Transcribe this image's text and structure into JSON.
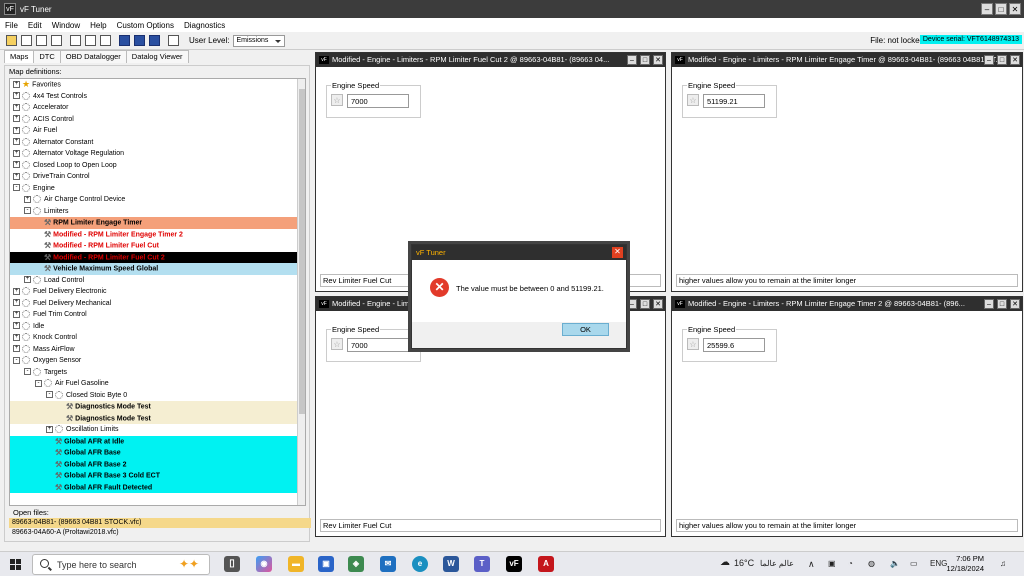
{
  "app": {
    "title": "vF Tuner"
  },
  "menu": [
    "File",
    "Edit",
    "Window",
    "Help",
    "Custom Options",
    "Diagnostics"
  ],
  "toolbar": {
    "user_level_label": "User Level:",
    "user_level_value": "Emissions",
    "file_status": "File: not locked",
    "device_serial": "Device serial: VFT6148974313"
  },
  "left": {
    "tabs": [
      "Maps",
      "DTC",
      "OBD Datalogger",
      "Datalog Viewer"
    ],
    "map_definitions_label": "Map definitions:",
    "tree": [
      {
        "label": "Favorites",
        "indent": 0,
        "exp": "+",
        "icon": "star",
        "style": ""
      },
      {
        "label": "4x4 Test Controls",
        "indent": 0,
        "exp": "+",
        "icon": "gear",
        "style": ""
      },
      {
        "label": "Accelerator",
        "indent": 0,
        "exp": "+",
        "icon": "gear",
        "style": ""
      },
      {
        "label": "ACIS Control",
        "indent": 0,
        "exp": "+",
        "icon": "gear",
        "style": ""
      },
      {
        "label": "Air Fuel",
        "indent": 0,
        "exp": "+",
        "icon": "gear",
        "style": ""
      },
      {
        "label": "Alternator Constant",
        "indent": 0,
        "exp": "+",
        "icon": "gear",
        "style": ""
      },
      {
        "label": "Alternator Voltage Regulation",
        "indent": 0,
        "exp": "+",
        "icon": "gear",
        "style": ""
      },
      {
        "label": "Closed Loop to Open Loop",
        "indent": 0,
        "exp": "+",
        "icon": "gear",
        "style": ""
      },
      {
        "label": "DriveTrain Control",
        "indent": 0,
        "exp": "+",
        "icon": "gear",
        "style": ""
      },
      {
        "label": "Engine",
        "indent": 0,
        "exp": "-",
        "icon": "gear",
        "style": ""
      },
      {
        "label": "Air Charge Control Device",
        "indent": 1,
        "exp": "+",
        "icon": "gear",
        "style": ""
      },
      {
        "label": "Limiters",
        "indent": 1,
        "exp": "-",
        "icon": "gear",
        "style": ""
      },
      {
        "label": "RPM Limiter Engage Timer",
        "indent": 2,
        "exp": "",
        "icon": "wrench",
        "style": "orange"
      },
      {
        "label": "Modified - RPM Limiter Engage Timer 2",
        "indent": 2,
        "exp": "",
        "icon": "wrench",
        "style": "redtxt"
      },
      {
        "label": "Modified - RPM Limiter Fuel Cut",
        "indent": 2,
        "exp": "",
        "icon": "wrench",
        "style": "redtxt"
      },
      {
        "label": "Modified - RPM Limiter Fuel Cut 2",
        "indent": 2,
        "exp": "",
        "icon": "wrench",
        "style": "black"
      },
      {
        "label": "Vehicle Maximum Speed Global",
        "indent": 2,
        "exp": "",
        "icon": "wrench",
        "style": "lblue"
      },
      {
        "label": "Load Control",
        "indent": 1,
        "exp": "+",
        "icon": "gear",
        "style": ""
      },
      {
        "label": "Fuel Delivery Electronic",
        "indent": 0,
        "exp": "+",
        "icon": "gear",
        "style": ""
      },
      {
        "label": "Fuel Delivery Mechanical",
        "indent": 0,
        "exp": "+",
        "icon": "gear",
        "style": ""
      },
      {
        "label": "Fuel Trim Control",
        "indent": 0,
        "exp": "+",
        "icon": "gear",
        "style": ""
      },
      {
        "label": "Idle",
        "indent": 0,
        "exp": "+",
        "icon": "gear",
        "style": ""
      },
      {
        "label": "Knock Control",
        "indent": 0,
        "exp": "+",
        "icon": "gear",
        "style": ""
      },
      {
        "label": "Mass AirFlow",
        "indent": 0,
        "exp": "+",
        "icon": "gear",
        "style": ""
      },
      {
        "label": "Oxygen Sensor",
        "indent": 0,
        "exp": "-",
        "icon": "gear",
        "style": ""
      },
      {
        "label": "Targets",
        "indent": 1,
        "exp": "-",
        "icon": "gear",
        "style": ""
      },
      {
        "label": "Air Fuel Gasoline",
        "indent": 2,
        "exp": "-",
        "icon": "gear",
        "style": ""
      },
      {
        "label": "Closed Stoic Byte 0",
        "indent": 3,
        "exp": "-",
        "icon": "gear",
        "style": ""
      },
      {
        "label": "Diagnostics Mode Test",
        "indent": 4,
        "exp": "",
        "icon": "wrench",
        "style": "beige"
      },
      {
        "label": "Diagnostics Mode Test",
        "indent": 4,
        "exp": "",
        "icon": "wrench",
        "style": "beige"
      },
      {
        "label": "Oscillation Limits",
        "indent": 3,
        "exp": "+",
        "icon": "gear",
        "style": ""
      },
      {
        "label": "Global AFR at Idle",
        "indent": 3,
        "exp": "",
        "icon": "wrench",
        "style": "cyan"
      },
      {
        "label": "Global AFR Base",
        "indent": 3,
        "exp": "",
        "icon": "wrench",
        "style": "cyan"
      },
      {
        "label": "Global AFR Base 2",
        "indent": 3,
        "exp": "",
        "icon": "wrench",
        "style": "cyan"
      },
      {
        "label": "Global AFR Base 3 Cold ECT",
        "indent": 3,
        "exp": "",
        "icon": "wrench",
        "style": "cyan"
      },
      {
        "label": "Global AFR Fault Detected",
        "indent": 3,
        "exp": "",
        "icon": "wrench",
        "style": "cyan"
      }
    ],
    "open_files_label": "Open files:",
    "open_files": [
      "89663-04B81- (89663 04B81 STOCK.vfc)",
      "89663-04A60-A (Proltawi2018.vfc)"
    ]
  },
  "windows": [
    {
      "title": "Modified - Engine - Limiters - RPM Limiter Fuel Cut 2 @ 89663-04B81- (89663 04...",
      "group_label": "Engine Speed",
      "value": "7000",
      "desc": "Rev Limiter Fuel Cut"
    },
    {
      "title": "Modified - Engine - Limiters - RPM Limiter Engage Timer @ 89663-04B81- (89663 04B81 ST...",
      "group_label": "Engine Speed",
      "value": "51199.21",
      "desc": "higher values allow you to remain at the limiter longer"
    },
    {
      "title": "Modified - Engine - Limiters",
      "group_label": "Engine Speed",
      "value": "7000",
      "desc": "Rev Limiter Fuel Cut"
    },
    {
      "title": "Modified - Engine - Limiters - RPM Limiter Engage Timer 2 @ 89663-04B81- (896...",
      "group_label": "Engine Speed",
      "value": "25599.6",
      "desc": "higher values allow you to remain at the limiter longer"
    }
  ],
  "dialog": {
    "title": "vF Tuner",
    "message": "The value must be between 0 and 51199.21.",
    "ok": "OK"
  },
  "taskbar": {
    "search_placeholder": "Type here to search",
    "weather": "16°C",
    "weather_text": "عالم عالما",
    "lang": "ENG",
    "time": "7:06 PM",
    "date": "12/18/2024"
  }
}
